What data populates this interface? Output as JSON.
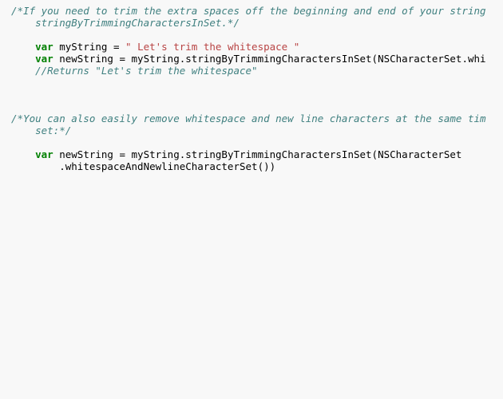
{
  "code": {
    "c1": "/*If you need to trim the extra spaces off the beginning and end of your string",
    "c1b": "    stringByTrimmingCharactersInSet.*/",
    "blank1": "",
    "indent1": "    ",
    "kw_var": "var",
    "sp": " ",
    "id_myString": "myString",
    "eq": " = ",
    "str1": "\" Let's trim the whitespace \"",
    "id_newString": "newString",
    "expr1": "myString.stringByTrimmingCharactersInSet(NSCharacterSet.whi",
    "c2": "//Returns \"Let's trim the whitespace\"",
    "blank2": "",
    "blank3": "",
    "blank4": "",
    "c3a": "/*You can also easily remove whitespace and new line characters at the same tim",
    "c3b": "    set:*/",
    "blank5": "",
    "expr2a": "myString.stringByTrimmingCharactersInSet(NSCharacterSet",
    "indent2": "        ",
    "expr2b": ".whitespaceAndNewlineCharacterSet())"
  }
}
